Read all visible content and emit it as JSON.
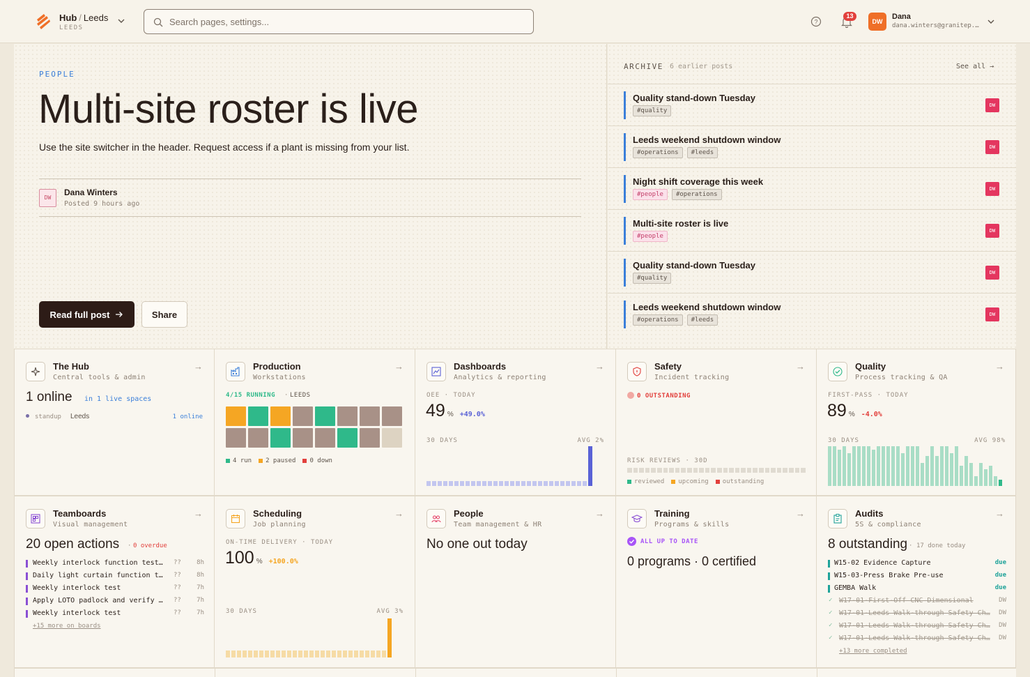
{
  "header": {
    "brand": "Hub",
    "site": "Leeds",
    "site_sub": "LEEDS",
    "search_placeholder": "Search pages, settings...",
    "notif_count": "13",
    "user_initials": "DW",
    "user_name": "Dana",
    "user_email": "dana.winters@granitep..."
  },
  "hero": {
    "category": "PEOPLE",
    "title": "Multi-site roster is live",
    "body": "Use the site switcher in the header. Request access if a plant is missing from your list.",
    "author_initials": "DW",
    "author_name": "Dana Winters",
    "author_time": "Posted 9 hours ago",
    "read_label": "Read full post",
    "share_label": "Share"
  },
  "archive": {
    "heading": "ARCHIVE",
    "count": "6 earlier posts",
    "see_all": "See all →",
    "items": [
      {
        "title": "Quality stand-down Tuesday",
        "tags": [
          {
            "t": "#quality",
            "pink": false
          }
        ],
        "initials": "DW"
      },
      {
        "title": "Leeds weekend shutdown window",
        "tags": [
          {
            "t": "#operations",
            "pink": false
          },
          {
            "t": "#leeds",
            "pink": false
          }
        ],
        "initials": "DW"
      },
      {
        "title": "Night shift coverage this week",
        "tags": [
          {
            "t": "#people",
            "pink": true
          },
          {
            "t": "#operations",
            "pink": false
          }
        ],
        "initials": "DW"
      },
      {
        "title": "Multi-site roster is live",
        "tags": [
          {
            "t": "#people",
            "pink": true
          }
        ],
        "initials": "DW"
      },
      {
        "title": "Quality stand-down Tuesday",
        "tags": [
          {
            "t": "#quality",
            "pink": false
          }
        ],
        "initials": "DW"
      },
      {
        "title": "Leeds weekend shutdown window",
        "tags": [
          {
            "t": "#operations",
            "pink": false
          },
          {
            "t": "#leeds",
            "pink": false
          }
        ],
        "initials": "DW"
      }
    ]
  },
  "cards": {
    "hub": {
      "title": "The Hub",
      "sub": "Central tools & admin",
      "online_big": "1 online",
      "online_note": "in 1 live spaces",
      "space_name": "standup",
      "space_site": "Leeds",
      "space_count": "1 online"
    },
    "production": {
      "title": "Production",
      "sub": "Workstations",
      "running": "4/15 RUNNING",
      "site": "LEEDS",
      "legend_run": "4 run",
      "legend_paused": "2 paused",
      "legend_down": "0 down",
      "tiles": [
        "paused",
        "run",
        "paused",
        "idle",
        "run",
        "idle",
        "idle",
        "idle",
        "idle",
        "idle",
        "run",
        "idle",
        "idle",
        "run",
        "idle",
        "empty"
      ]
    },
    "dashboards": {
      "title": "Dashboards",
      "sub": "Analytics & reporting",
      "label": "OEE · TODAY",
      "value": "49",
      "unit": "%",
      "delta": "+49.0%",
      "days": "30 DAYS",
      "avg": "AVG 2%",
      "bars": [
        12,
        12,
        12,
        12,
        12,
        12,
        12,
        12,
        12,
        12,
        12,
        12,
        12,
        12,
        12,
        12,
        12,
        12,
        12,
        12,
        12,
        12,
        12,
        12,
        12,
        12,
        12,
        12,
        12,
        100
      ]
    },
    "safety": {
      "title": "Safety",
      "sub": "Incident tracking",
      "outstanding": "0 OUTSTANDING",
      "risk_label": "RISK REVIEWS · 30D",
      "legend_reviewed": "reviewed",
      "legend_upcoming": "upcoming",
      "legend_outstanding": "outstanding"
    },
    "quality": {
      "title": "Quality",
      "sub": "Process tracking & QA",
      "label": "FIRST-PASS · TODAY",
      "value": "89",
      "unit": "%",
      "delta": "-4.0%",
      "days": "30 DAYS",
      "avg": "AVG 98%",
      "bars": [
        100,
        100,
        92,
        100,
        83,
        100,
        100,
        100,
        100,
        92,
        100,
        100,
        100,
        100,
        100,
        83,
        100,
        100,
        100,
        58,
        75,
        100,
        75,
        100,
        100,
        83,
        100,
        50,
        75,
        58,
        25,
        58,
        42,
        50,
        25,
        15
      ]
    },
    "teamboards": {
      "title": "Teamboards",
      "sub": "Visual management",
      "big": "20 open actions",
      "overdue": "0 overdue",
      "more": "+15 more on boards",
      "actions": [
        {
          "text": "Weekly interlock function test…",
          "who": "??",
          "age": "8h"
        },
        {
          "text": "Daily light curtain function t…",
          "who": "??",
          "age": "8h"
        },
        {
          "text": "Weekly interlock test",
          "who": "??",
          "age": "7h"
        },
        {
          "text": "Apply LOTO padlock and verify …",
          "who": "??",
          "age": "7h"
        },
        {
          "text": "Weekly interlock test",
          "who": "??",
          "age": "7h"
        }
      ]
    },
    "scheduling": {
      "title": "Scheduling",
      "sub": "Job planning",
      "label": "ON-TIME DELIVERY · TODAY",
      "value": "100",
      "unit": "%",
      "delta": "+100.0%",
      "days": "30 DAYS",
      "avg": "AVG 3%",
      "bars": [
        18,
        18,
        18,
        18,
        18,
        18,
        18,
        18,
        18,
        18,
        18,
        18,
        18,
        18,
        18,
        18,
        18,
        18,
        18,
        18,
        18,
        18,
        18,
        18,
        18,
        18,
        18,
        18,
        18,
        100
      ]
    },
    "people": {
      "title": "People",
      "sub": "Team management & HR",
      "big": "No one out today"
    },
    "training": {
      "title": "Training",
      "sub": "Programs & skills",
      "status": "ALL UP TO DATE",
      "big": "0 programs · 0 certified"
    },
    "audits": {
      "title": "Audits",
      "sub": "5S & compliance",
      "big": "8 outstanding",
      "done": "17 done today",
      "more": "+13 more completed",
      "due": [
        {
          "text": "W15-02 Evidence Capture",
          "state": "due"
        },
        {
          "text": "W15-03-Press Brake Pre-use",
          "state": "due"
        },
        {
          "text": "GEMBA Walk",
          "state": "due"
        }
      ],
      "completed": [
        {
          "text": "W17-01-First-Off CNC Dimensional",
          "who": "DW"
        },
        {
          "text": "W17-01-Leeds Walk-through Safety Ch…",
          "who": "DW"
        },
        {
          "text": "W17-01-Leeds Walk-through Safety Ch…",
          "who": "DW"
        },
        {
          "text": "W17-01-Leeds Walk-through Safety Ch…",
          "who": "DW"
        }
      ]
    }
  },
  "colors": {
    "accent": "#3b7fd9",
    "brand": "#ef6f28",
    "dark": "#2d1c17",
    "run": "#2fb98a",
    "paused": "#f5a623",
    "idle": "#a89187",
    "down": "#e2403c"
  }
}
